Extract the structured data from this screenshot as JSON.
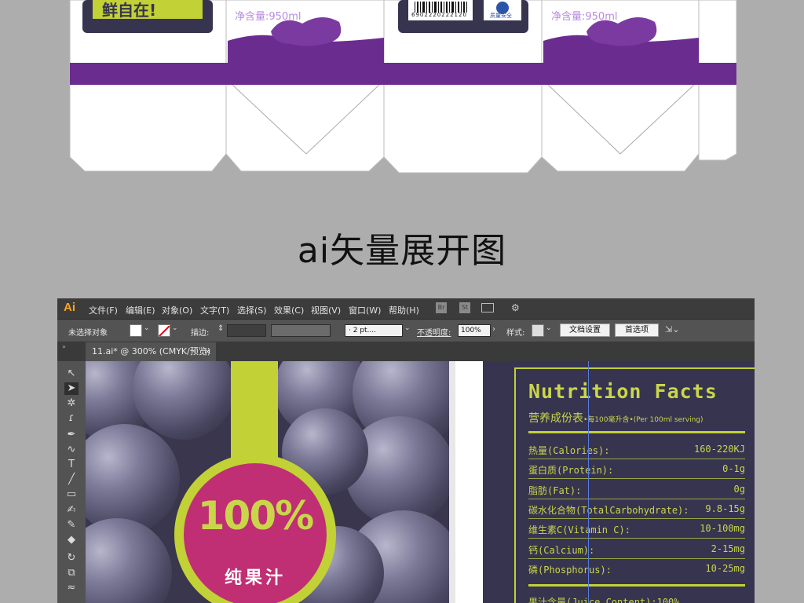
{
  "package": {
    "slogan_fragment": "鲜自在!",
    "net_content_left": "净含量:950ml",
    "net_content_right": "净含量:950ml",
    "barcode_number": "6902220222120",
    "qs_label": "质量安全"
  },
  "heading": "ai矢量展开图",
  "app": {
    "logo": "Ai",
    "menu": [
      "文件(F)",
      "编辑(E)",
      "对象(O)",
      "文字(T)",
      "选择(S)",
      "效果(C)",
      "视图(V)",
      "窗口(W)",
      "帮助(H)"
    ],
    "menu_right_icons": [
      "Br",
      "St"
    ]
  },
  "control_bar": {
    "no_selection": "未选择对象",
    "stroke_label": "描边:",
    "stroke_weight": "· 2 pt....",
    "opacity_label": "不透明度:",
    "opacity_value": "100%",
    "style_label": "样式:",
    "doc_setup_button": "文档设置",
    "preferences_button": "首选项"
  },
  "document_tab": {
    "title": "11.ai* @ 300% (CMYK/预览)",
    "close": "×"
  },
  "tools": [
    "selection-tool",
    "direct-selection-tool",
    "magic-wand-tool",
    "lasso-tool",
    "pen-tool",
    "curvature-tool",
    "type-tool",
    "line-tool",
    "rectangle-tool",
    "paintbrush-tool",
    "shaper-tool",
    "eraser-tool",
    "rotate-tool",
    "scale-tool",
    "width-tool"
  ],
  "artwork": {
    "badge_percent": "100%",
    "badge_text": "纯果汁"
  },
  "nutrition": {
    "title": "Nutrition Facts",
    "subtitle_cn": "营养成份表",
    "subtitle_small": "•每100毫升含•(Per 100ml serving)",
    "rows": [
      {
        "label": "热量(Calories):",
        "value": "160-220KJ"
      },
      {
        "label": "蛋白质(Protein):",
        "value": "0-1g"
      },
      {
        "label": "脂肪(Fat):",
        "value": "0g"
      },
      {
        "label": "碳水化合物(TotalCarbohydrate):",
        "value": "9.8-15g"
      },
      {
        "label": "维生素C(Vitamin C):",
        "value": "10-100mg"
      },
      {
        "label": "钙(Calcium):",
        "value": "2-15mg"
      },
      {
        "label": "磷(Phosphorus):",
        "value": "10-25mg"
      }
    ],
    "footer_partial": "果汁含量(Juice Content):100%"
  },
  "colors": {
    "brand_purple": "#6b2c8f",
    "lime": "#c2d136",
    "magenta": "#c02e74",
    "panel_navy": "#37344f",
    "ai_orange": "#f6a521"
  }
}
